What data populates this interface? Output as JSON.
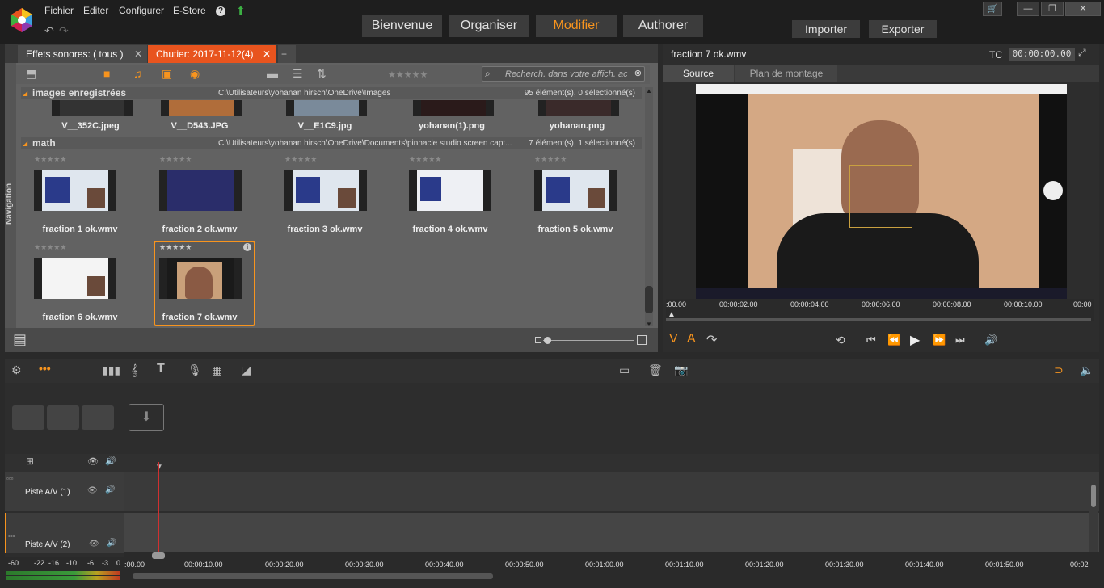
{
  "menu": {
    "file": "Fichier",
    "edit": "Editer",
    "configure": "Configurer",
    "estore": "E-Store",
    "help": "?"
  },
  "modes": {
    "welcome": "Bienvenue",
    "organize": "Organiser",
    "edit": "Modifier",
    "author": "Authorer"
  },
  "actions": {
    "import": "Importer",
    "export": "Exporter"
  },
  "library": {
    "tabs": [
      {
        "label": "Effets sonores: ( tous )"
      },
      {
        "label": "Chutier: 2017-11-12(4)"
      }
    ],
    "search_placeholder": "Recherch. dans votre affich. ac",
    "nav_label": "Navigation",
    "sections": [
      {
        "name": "images enregistrées",
        "path": "C:\\Utilisateurs\\yohanan hirsch\\OneDrive\\Images",
        "count": "95 élément(s), 0 sélectionné(s)",
        "items": [
          "V__352C.jpeg",
          "V__D543.JPG",
          "V__E1C9.jpg",
          "yohanan(1).png",
          "yohanan.png"
        ]
      },
      {
        "name": "math",
        "path": "C:\\Utilisateurs\\yohanan hirsch\\OneDrive\\Documents\\pinnacle studio screen capt...",
        "count": "7 élément(s), 1 sélectionné(s)",
        "items": [
          "fraction 1 ok.wmv",
          "fraction 2 ok.wmv",
          "fraction 3 ok.wmv",
          "fraction 4 ok.wmv",
          "fraction 5 ok.wmv",
          "fraction 6 ok.wmv",
          "fraction 7 ok.wmv"
        ]
      }
    ],
    "stars": "★★★★★"
  },
  "preview": {
    "title": "fraction 7 ok.wmv",
    "tc_label": "TC",
    "timecode": "00:00:00.00",
    "tabs": {
      "source": "Source",
      "storyboard": "Plan de montage"
    },
    "ruler": [
      ":00.00",
      "00:00:02.00",
      "00:00:04.00",
      "00:00:06.00",
      "00:00:08.00",
      "00:00:10.00",
      "00:00"
    ],
    "va": {
      "v": "V",
      "a": "A"
    }
  },
  "timeline": {
    "tracks": [
      {
        "label": "Piste A/V (1)"
      },
      {
        "label": "Piste A/V (2)"
      }
    ],
    "meter": [
      "-60",
      "-22",
      "-16",
      "-10",
      "-6",
      "-3",
      "0"
    ],
    "ruler": [
      ":00.00",
      "00:00:10.00",
      "00:00:20.00",
      "00:00:30.00",
      "00:00:40.00",
      "00:00:50.00",
      "00:01:00.00",
      "00:01:10.00",
      "00:01:20.00",
      "00:01:30.00",
      "00:01:40.00",
      "00:01:50.00",
      "00:02"
    ]
  },
  "colors": {
    "accent": "#f7941e",
    "active_tab": "#e8541e",
    "playhead": "#d03030"
  }
}
